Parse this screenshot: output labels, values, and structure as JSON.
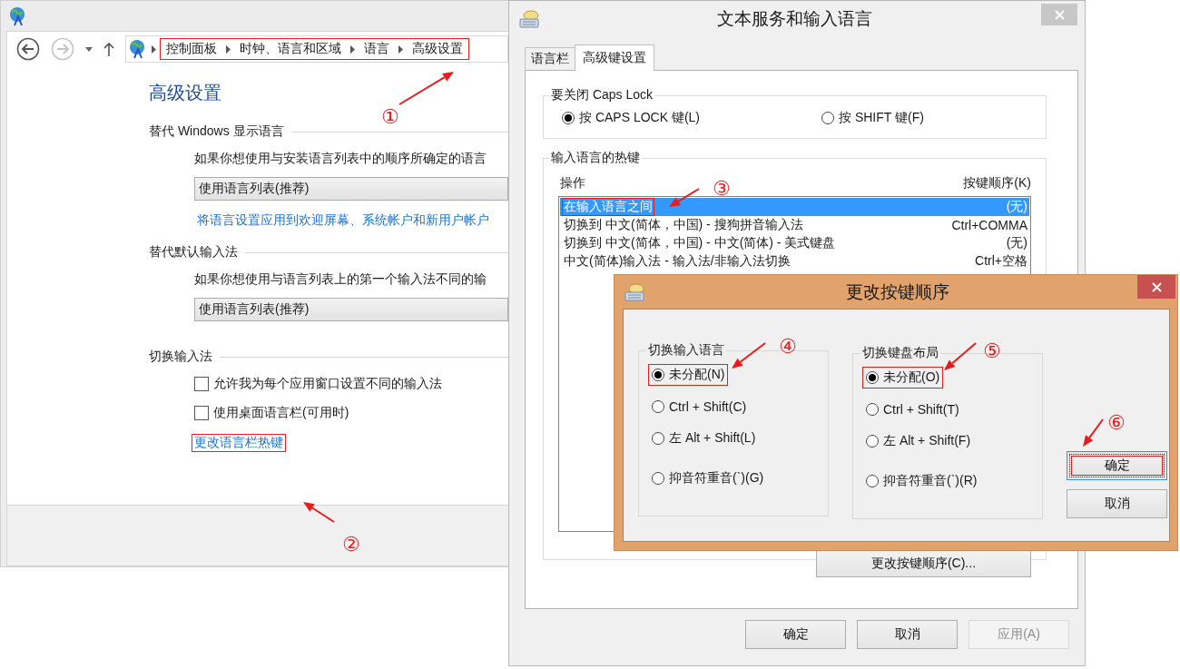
{
  "control_panel": {
    "breadcrumb": [
      {
        "label": "控制面板"
      },
      {
        "label": "时钟、语言和区域"
      },
      {
        "label": "语言"
      },
      {
        "label": "高级设置"
      }
    ],
    "breadcrumb_outlined": true,
    "heading": "高级设置",
    "sections": [
      {
        "title": "替代 Windows 显示语言",
        "description": "如果你想使用与安装语言列表中的顺序所确定的语言",
        "dropdown": "使用语言列表(推荐)",
        "link": "将语言设置应用到欢迎屏幕、系统帐户和新用户帐户",
        "link_outlined": false
      },
      {
        "title": "替代默认输入法",
        "description": "如果你想使用与语言列表上的第一个输入法不同的输",
        "dropdown": "使用语言列表(推荐)"
      },
      {
        "title": "切换输入法",
        "checkboxes": [
          {
            "label": "允许我为每个应用窗口设置不同的输入法",
            "checked": false
          },
          {
            "label": "使用桌面语言栏(可用时)",
            "checked": false
          }
        ],
        "link": "更改语言栏热键",
        "link_outlined": true
      }
    ]
  },
  "text_services_dialog": {
    "title": "文本服务和输入语言",
    "tabs": [
      {
        "label": "语言栏",
        "selected": false
      },
      {
        "label": "高级键设置",
        "selected": true
      }
    ],
    "caps_lock_group": {
      "title": "要关闭 Caps Lock",
      "options": [
        {
          "label": "按 CAPS LOCK 键(L)",
          "selected": true
        },
        {
          "label": "按 SHIFT 键(F)",
          "selected": false
        }
      ]
    },
    "hotkeys_group": {
      "title": "输入语言的热键",
      "columns": [
        "操作",
        "按键顺序(K)"
      ],
      "rows": [
        {
          "action": "在输入语言之间",
          "keys": "(无)",
          "selected": true,
          "outlined": true
        },
        {
          "action": "切换到 中文(简体，中国) - 搜狗拼音输入法",
          "keys": "Ctrl+COMMA",
          "selected": false,
          "outlined": false
        },
        {
          "action": "切换到 中文(简体，中国) - 中文(简体) - 美式键盘",
          "keys": "(无)",
          "selected": false,
          "outlined": false
        },
        {
          "action": "中文(简体)输入法 - 输入法/非输入法切换",
          "keys": "Ctrl+空格",
          "selected": false,
          "outlined": false
        }
      ],
      "button": "更改按键顺序(C)..."
    },
    "buttons": [
      {
        "label": "确定",
        "disabled": false
      },
      {
        "label": "取消",
        "disabled": false
      },
      {
        "label": "应用(A)",
        "disabled": true
      }
    ]
  },
  "change_key_sequence_dialog": {
    "title": "更改按键顺序",
    "groups": [
      {
        "title": "切换输入语言",
        "options": [
          {
            "label": "未分配(N)",
            "selected": true,
            "outlined": true
          },
          {
            "label": "Ctrl + Shift(C)",
            "selected": false,
            "outlined": false
          },
          {
            "label": "左 Alt + Shift(L)",
            "selected": false,
            "outlined": false
          },
          {
            "label": "抑音符重音(`)(G)",
            "selected": false,
            "outlined": false
          }
        ]
      },
      {
        "title": "切换键盘布局",
        "options": [
          {
            "label": "未分配(O)",
            "selected": true,
            "outlined": true
          },
          {
            "label": "Ctrl + Shift(T)",
            "selected": false,
            "outlined": false
          },
          {
            "label": "左 Alt + Shift(F)",
            "selected": false,
            "outlined": false
          },
          {
            "label": "抑音符重音(`)(R)",
            "selected": false,
            "outlined": false
          }
        ]
      }
    ],
    "buttons": [
      {
        "label": "确定",
        "default": true,
        "outlined": true
      },
      {
        "label": "取消",
        "default": false,
        "outlined": false
      }
    ]
  },
  "annotations": [
    {
      "label": "①"
    },
    {
      "label": "②"
    },
    {
      "label": "③"
    },
    {
      "label": "④"
    },
    {
      "label": "⑤"
    },
    {
      "label": "⑥"
    }
  ]
}
